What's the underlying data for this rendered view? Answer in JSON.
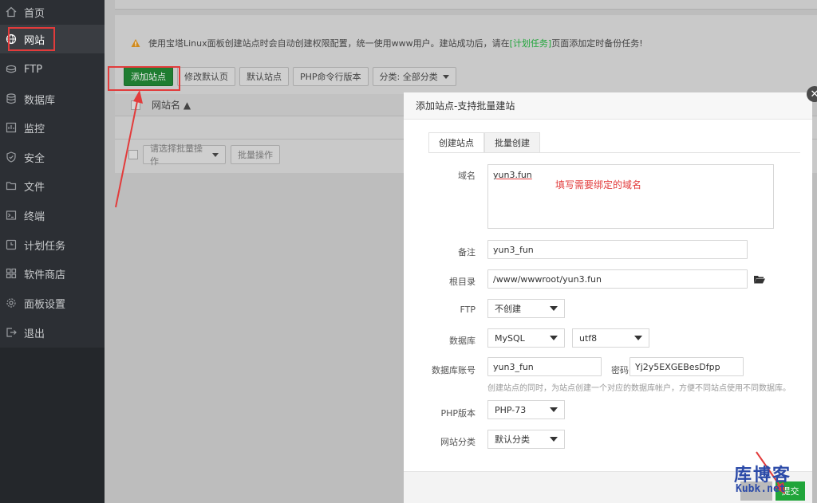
{
  "sidebar": {
    "items": [
      {
        "label": "首页",
        "icon": "home-icon"
      },
      {
        "label": "网站",
        "icon": "globe-icon"
      },
      {
        "label": "FTP",
        "icon": "ftp-icon"
      },
      {
        "label": "数据库",
        "icon": "database-icon"
      },
      {
        "label": "监控",
        "icon": "monitor-icon"
      },
      {
        "label": "安全",
        "icon": "shield-icon"
      },
      {
        "label": "文件",
        "icon": "folder-icon"
      },
      {
        "label": "终端",
        "icon": "terminal-icon"
      },
      {
        "label": "计划任务",
        "icon": "clock-icon"
      },
      {
        "label": "软件商店",
        "icon": "grid-icon"
      },
      {
        "label": "面板设置",
        "icon": "gear-icon"
      },
      {
        "label": "退出",
        "icon": "logout-icon"
      }
    ],
    "active_index": 1
  },
  "notice": {
    "text_before": "使用宝塔Linux面板创建站点时会自动创建权限配置，统一使用www用户。建站成功后，请在",
    "link": "[计划任务]",
    "text_after": "页面添加定时备份任务!"
  },
  "toolbar": {
    "add_site": "添加站点",
    "edit_default_page": "修改默认页",
    "default_site": "默认站点",
    "php_cli": "PHP命令行版本",
    "category": "分类: 全部分类"
  },
  "table": {
    "col_name": "网站名 ▲"
  },
  "batch": {
    "select_placeholder": "请选择批量操作",
    "button": "批量操作"
  },
  "modal": {
    "title": "添加站点-支持批量建站",
    "tabs": [
      "创建站点",
      "批量创建"
    ],
    "labels": {
      "domain": "域名",
      "remark": "备注",
      "root": "根目录",
      "ftp": "FTP",
      "database": "数据库",
      "db_account": "数据库账号",
      "password": "密码",
      "php_version": "PHP版本",
      "category": "网站分类"
    },
    "values": {
      "domain": "yun3.fun",
      "remark": "yun3_fun",
      "root": "/www/wwwroot/yun3.fun",
      "ftp": "不创建",
      "db_type": "MySQL",
      "charset": "utf8",
      "db_account": "yun3_fun",
      "password": "Yj2y5EXGEBesDfpp",
      "php_version": "PHP-73",
      "category": "默认分类"
    },
    "domain_hint": "填写需要绑定的域名",
    "db_note": "创建站点的同时，为站点创建一个对应的数据库帐户，方便不同站点使用不同数据库。",
    "submit": "提交"
  },
  "watermark": {
    "line1": "库博客",
    "line2": "Kubk.net"
  },
  "colors": {
    "sidebar_bg": "#2c2f34",
    "accent_green": "#20a53a",
    "annotation_red": "#e23b3b"
  }
}
